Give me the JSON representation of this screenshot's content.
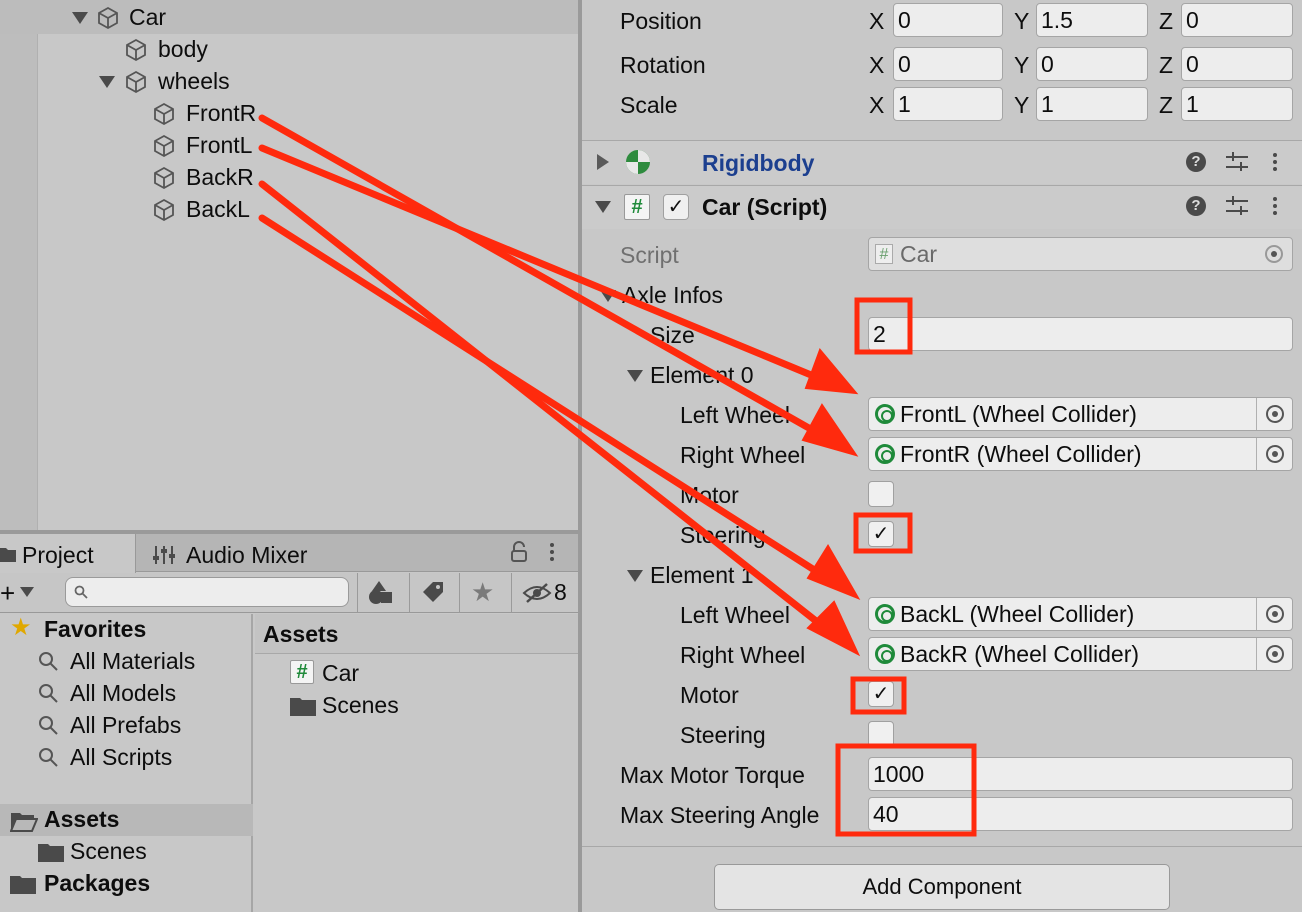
{
  "hierarchy": {
    "car": "Car",
    "body": "body",
    "wheels": "wheels",
    "front_r": "FrontR",
    "front_l": "FrontL",
    "back_r": "BackR",
    "back_l": "BackL"
  },
  "project": {
    "tab_project": "Project",
    "tab_audio_mixer": "Audio Mixer",
    "hidden_count": "8",
    "favorites": "Favorites",
    "fav_items": [
      "All Materials",
      "All Models",
      "All Prefabs",
      "All Scripts"
    ],
    "assets": "Assets",
    "assets_scenes": "Scenes",
    "packages": "Packages",
    "right_header": "Assets",
    "right_items": [
      "Car",
      "Scenes"
    ]
  },
  "transform": {
    "position_label": "Position",
    "rotation_label": "Rotation",
    "scale_label": "Scale",
    "x": "X",
    "y": "Y",
    "z": "Z",
    "position": [
      "0",
      "1.5",
      "0"
    ],
    "rotation": [
      "0",
      "0",
      "0"
    ],
    "scale": [
      "1",
      "1",
      "1"
    ]
  },
  "rigidbody": {
    "title": "Rigidbody"
  },
  "car_script": {
    "title": "Car (Script)",
    "script_label": "Script",
    "script_value": "Car",
    "axle_infos_label": "Axle Infos",
    "size_label": "Size",
    "size_value": "2",
    "element0_label": "Element 0",
    "element1_label": "Element 1",
    "left_wheel_label": "Left Wheel",
    "right_wheel_label": "Right Wheel",
    "motor_label": "Motor",
    "steering_label": "Steering",
    "e0_left": "FrontL (Wheel Collider)",
    "e0_right": "FrontR (Wheel Collider)",
    "e0_motor": false,
    "e0_steering": true,
    "e1_left": "BackL (Wheel Collider)",
    "e1_right": "BackR (Wheel Collider)",
    "e1_motor": true,
    "e1_steering": false,
    "max_motor_torque_label": "Max Motor Torque",
    "max_motor_torque": "1000",
    "max_steering_angle_label": "Max Steering Angle",
    "max_steering_angle": "40"
  },
  "add_component": "Add Component",
  "colors": {
    "panel": "#c8c8c8",
    "field": "#ededed",
    "rigidbody_title": "#1c3f8f",
    "annotation": "#ff2a0d",
    "wheel_icon": "#1f8a3a"
  }
}
